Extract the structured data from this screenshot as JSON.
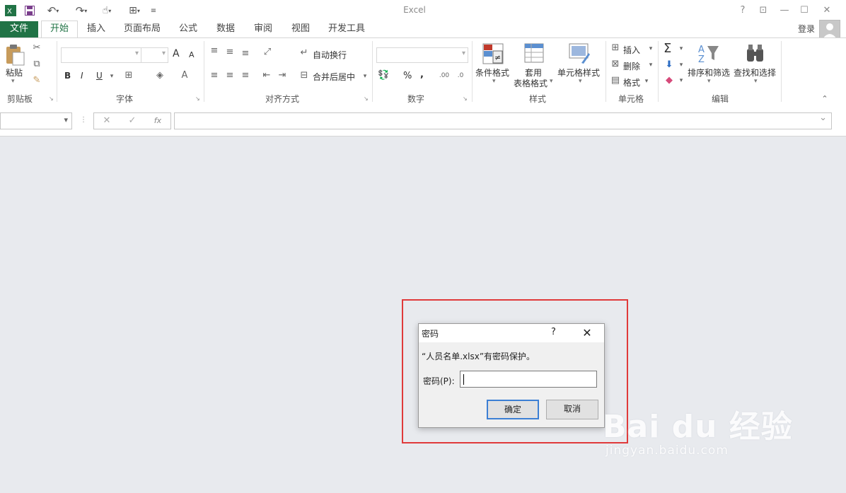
{
  "window": {
    "app_title": "Excel",
    "help": "?",
    "minimize": "—",
    "restore": "☐",
    "close": "✕"
  },
  "tabs": {
    "file": "文件",
    "items": [
      "开始",
      "插入",
      "页面布局",
      "公式",
      "数据",
      "审阅",
      "视图",
      "开发工具"
    ],
    "active": "开始",
    "login": "登录"
  },
  "ribbon": {
    "clipboard": {
      "paste": "粘贴",
      "label": "剪贴板"
    },
    "font": {
      "bold": "B",
      "italic": "I",
      "underline": "U",
      "grow": "A",
      "shrink": "A",
      "label": "字体"
    },
    "alignment": {
      "wrap_text": "自动换行",
      "merge_center": "合并后居中",
      "label": "对齐方式"
    },
    "number": {
      "percent": "%",
      "comma": ",",
      "label": "数字"
    },
    "styles": {
      "conditional": "条件格式",
      "table_format_1": "套用",
      "table_format_2": "表格格式",
      "cell_styles": "单元格样式",
      "label": "样式"
    },
    "cells": {
      "insert": "插入",
      "delete": "删除",
      "format": "格式",
      "label": "单元格"
    },
    "editing": {
      "sort_filter": "排序和筛选",
      "find_select": "查找和选择",
      "sigma": "Σ",
      "label": "编辑"
    }
  },
  "formula_bar": {
    "cancel": "✕",
    "enter": "✓",
    "fx": "fx"
  },
  "dialog": {
    "title": "密码",
    "help": "?",
    "close": "✕",
    "message": "“人员名单.xlsx”有密码保护。",
    "password_label": "密码(P):",
    "password_value": "",
    "ok": "确定",
    "cancel": "取消"
  },
  "watermark": {
    "main": "Bai du 经验",
    "sub": "jingyan.baidu.com"
  },
  "colors": {
    "brand": "#217346",
    "highlight": "#e03a3a",
    "canvas": "#e8eaee"
  }
}
